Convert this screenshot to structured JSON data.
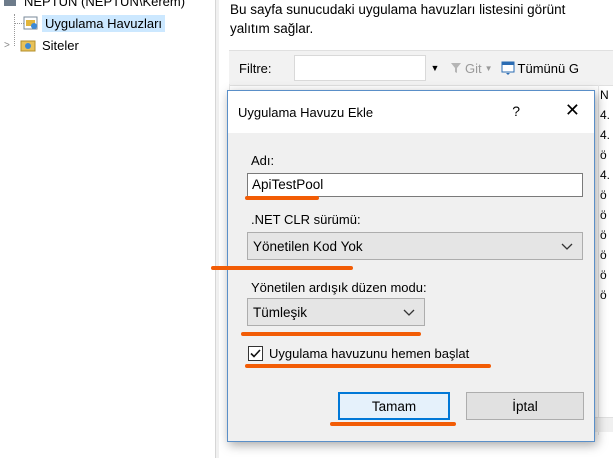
{
  "tree": {
    "server": "NEPTUN (NEPTUN\\Kerem)",
    "app_pools": "Uygulama Havuzları",
    "sites": "Siteler"
  },
  "description": {
    "line1": "Bu sayfa sunucudaki uygulama havuzları listesini görünt",
    "line2": "yalıtım sağlar."
  },
  "filter": {
    "label": "Filtre:",
    "value": "",
    "go": "Git",
    "show_all": "Tümünü G"
  },
  "column_edge": [
    "N",
    "4.",
    "4.",
    "ö",
    "4.",
    "ö",
    "ö",
    "ö",
    "ö",
    "ö",
    "ö"
  ],
  "dialog": {
    "title": "Uygulama Havuzu Ekle",
    "help": "?",
    "close": "✕",
    "name_label": "Adı:",
    "name_value": "ApiTestPool",
    "clr_label": ".NET CLR sürümü:",
    "clr_value": "Yönetilen Kod Yok",
    "pipeline_label": "Yönetilen ardışık düzen modu:",
    "pipeline_value": "Tümleşik",
    "start_label": "Uygulama havuzunu hemen başlat",
    "start_checked": true,
    "ok": "Tamam",
    "cancel": "İptal"
  },
  "colors": {
    "annotation": "#f25c05",
    "accent": "#0078d7",
    "selection": "#cce8ff"
  }
}
